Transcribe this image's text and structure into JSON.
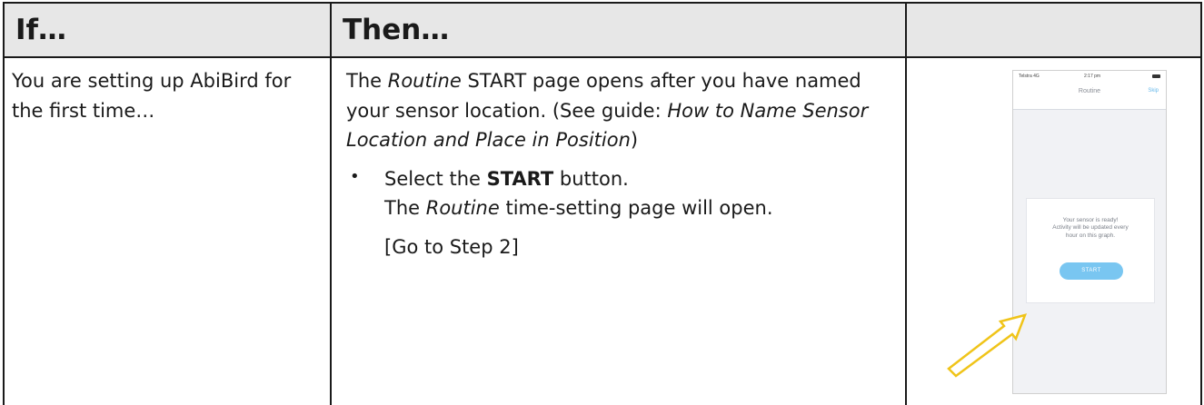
{
  "table": {
    "header_if": "If…",
    "header_then": "Then…",
    "header_image": ""
  },
  "if_cell": {
    "text": "You are setting up AbiBird for the first time…"
  },
  "then_cell": {
    "intro_pre": "The ",
    "intro_routine": "Routine",
    "intro_mid": " START page opens after you have named your sensor location. (See guide: ",
    "intro_guide": "How to Name Sensor Location and Place in Position",
    "intro_post": ")",
    "bullet": "•",
    "select_pre": "Select the ",
    "select_start": "START",
    "select_post": " button.",
    "result_pre": "The ",
    "result_routine": "Routine",
    "result_post": " time-setting page will open.",
    "step": "[Go to Step 2]"
  },
  "phone": {
    "carrier": "Telstra 4G",
    "time": "2:17 pm",
    "nav_title": "Routine",
    "nav_skip": "Skip",
    "card_line1": "Your sensor is ready!",
    "card_line2": "Activity will be updated every",
    "card_line3": "hour on this graph.",
    "start_button": "START"
  },
  "colors": {
    "header_bg": "#e7e7e7",
    "border": "#1a1a1a",
    "start_button": "#79c6f1",
    "skip_link": "#66b8ea",
    "arrow": "#f0c419"
  },
  "icons": [
    "arrow-pointer-icon",
    "battery-icon"
  ]
}
